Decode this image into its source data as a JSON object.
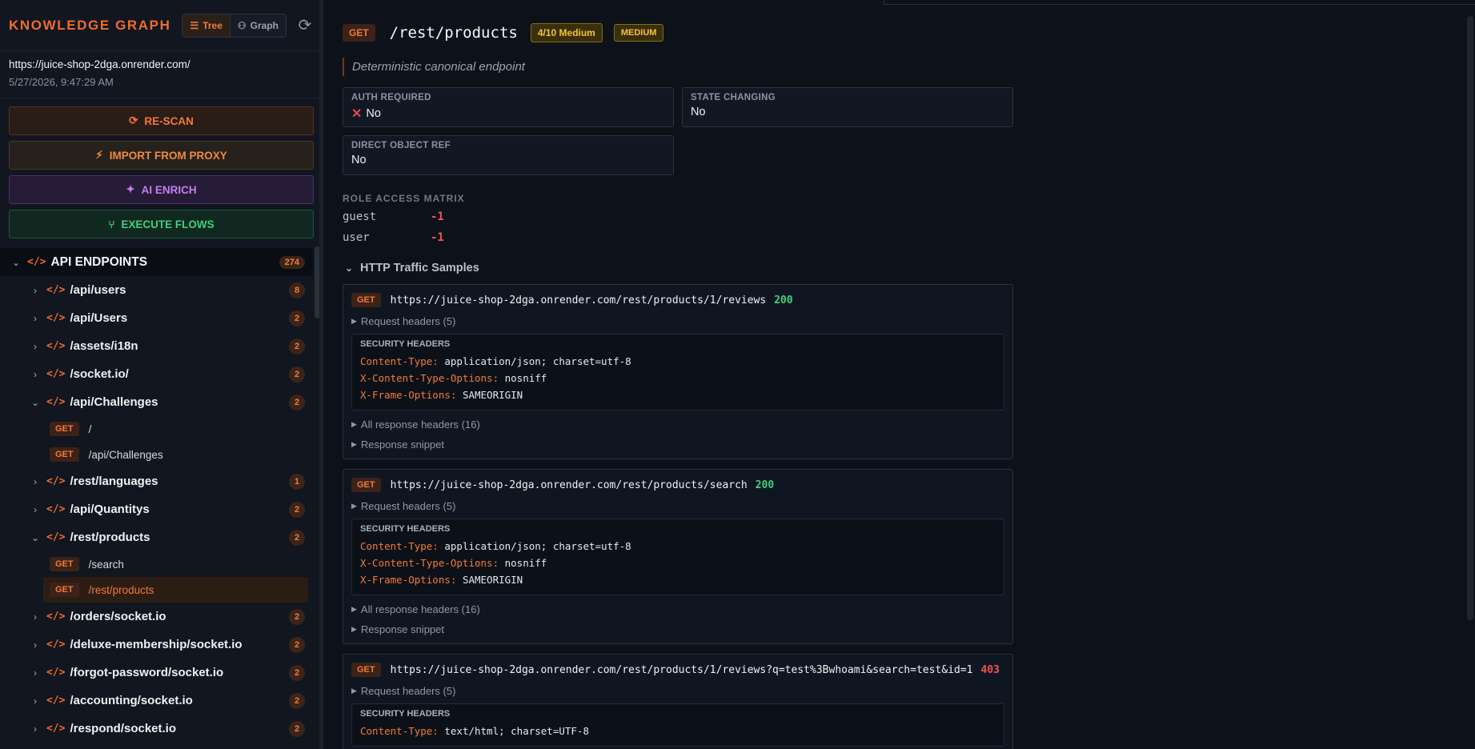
{
  "sidebar": {
    "title": "KNOWLEDGE GRAPH",
    "view_tree": "Tree",
    "view_graph": "Graph",
    "target_url": "https://juice-shop-2dga.onrender.com/",
    "target_time": "5/27/2026, 9:47:29 AM",
    "actions": {
      "rescan": "RE-SCAN",
      "import_proxy": "IMPORT FROM PROXY",
      "ai_enrich": "AI ENRICH",
      "execute_flows": "EXECUTE FLOWS"
    },
    "tree": {
      "root_label": "API ENDPOINTS",
      "root_count": "274",
      "nodes": [
        {
          "label": "/api/users",
          "count": "8"
        },
        {
          "label": "/api/Users",
          "count": "2"
        },
        {
          "label": "/assets/i18n",
          "count": "2"
        },
        {
          "label": "/socket.io/",
          "count": "2"
        },
        {
          "label": "/api/Challenges",
          "count": "2",
          "children": [
            {
              "method": "GET",
              "label": "/"
            },
            {
              "method": "GET",
              "label": "/api/Challenges"
            }
          ]
        },
        {
          "label": "/rest/languages",
          "count": "1"
        },
        {
          "label": "/api/Quantitys",
          "count": "2"
        },
        {
          "label": "/rest/products",
          "count": "2",
          "children": [
            {
              "method": "GET",
              "label": "/search"
            },
            {
              "method": "GET",
              "label": "/rest/products"
            }
          ]
        },
        {
          "label": "/orders/socket.io",
          "count": "2"
        },
        {
          "label": "/deluxe-membership/socket.io",
          "count": "2"
        },
        {
          "label": "/forgot-password/socket.io",
          "count": "2"
        },
        {
          "label": "/accounting/socket.io",
          "count": "2"
        },
        {
          "label": "/respond/socket.io",
          "count": "2"
        }
      ]
    }
  },
  "endpoint": {
    "method": "GET",
    "path": "/rest/products",
    "risk": "4/10 Medium",
    "severity": "MEDIUM",
    "description": "Deterministic canonical endpoint",
    "props": {
      "auth_required_label": "AUTH REQUIRED",
      "auth_required_value": "No",
      "state_changing_label": "STATE CHANGING",
      "state_changing_value": "No",
      "direct_object_label": "DIRECT OBJECT REF",
      "direct_object_value": "No"
    },
    "role_matrix_title": "ROLE ACCESS MATRIX",
    "roles": [
      {
        "role": "guest",
        "value": "-1"
      },
      {
        "role": "user",
        "value": "-1"
      }
    ]
  },
  "traffic": {
    "title": "HTTP Traffic Samples",
    "security_headers_title": "SECURITY HEADERS",
    "samples": [
      {
        "method": "GET",
        "url": "https://juice-shop-2dga.onrender.com/rest/products/1/reviews",
        "status": "200",
        "request_headers": "Request headers (5)",
        "headers": [
          {
            "k": "Content-Type:",
            "v": "application/json; charset=utf-8"
          },
          {
            "k": "X-Content-Type-Options:",
            "v": "nosniff"
          },
          {
            "k": "X-Frame-Options:",
            "v": "SAMEORIGIN"
          }
        ],
        "all_response_headers": "All response headers (16)",
        "snippet": "Response snippet"
      },
      {
        "method": "GET",
        "url": "https://juice-shop-2dga.onrender.com/rest/products/search",
        "status": "200",
        "request_headers": "Request headers (5)",
        "headers": [
          {
            "k": "Content-Type:",
            "v": "application/json; charset=utf-8"
          },
          {
            "k": "X-Content-Type-Options:",
            "v": "nosniff"
          },
          {
            "k": "X-Frame-Options:",
            "v": "SAMEORIGIN"
          }
        ],
        "all_response_headers": "All response headers (16)",
        "snippet": "Response snippet"
      },
      {
        "method": "GET",
        "url": "https://juice-shop-2dga.onrender.com/rest/products/1/reviews?q=test%3Bwhoami&search=test&id=1",
        "status": "403",
        "request_headers": "Request headers (5)",
        "headers": [
          {
            "k": "Content-Type:",
            "v": "text/html; charset=UTF-8"
          }
        ]
      }
    ]
  },
  "colors": {
    "accent": "#f26b2b",
    "ok": "#3fcf7d",
    "error": "#ef5353",
    "warning": "#f2c53b",
    "ai": "#c27ef0"
  },
  "icons": [
    "list-icon",
    "graph-icon",
    "refresh-icon",
    "bolt-icon",
    "sparkles-icon",
    "git-branch-icon",
    "code-icon",
    "chevron-down-icon",
    "chevron-right-icon",
    "x-icon"
  ]
}
